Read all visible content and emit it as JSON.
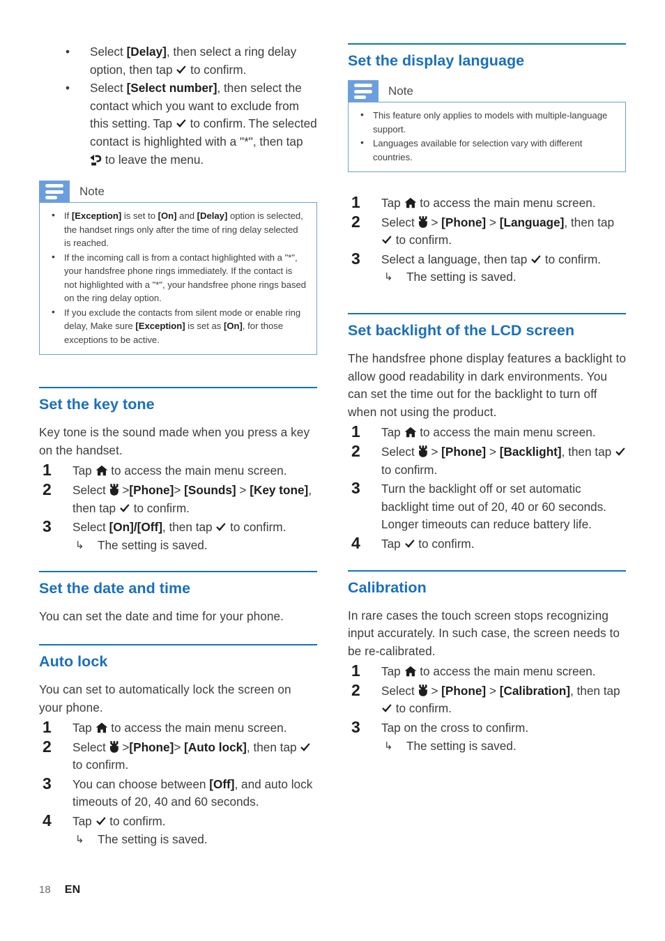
{
  "document": {
    "page_number": "18",
    "language_code": "EN"
  },
  "icons": {
    "check": "check-icon",
    "home": "home-icon",
    "wrench": "wrench-icon",
    "back": "back-arrow-icon",
    "sub_arrow": "sub-arrow-icon",
    "bullet": "•"
  },
  "colors": {
    "heading_blue": "#1a6fbd",
    "rule_blue": "#1272b6",
    "note_blue": "#6c9ede",
    "body_gray": "#3c3c3c"
  },
  "left_column": {
    "intro_bullets": [
      {
        "parts": [
          {
            "t": "Select ",
            "b": false
          },
          {
            "t": "[Delay]",
            "b": true
          },
          {
            "t": ", then select a ring delay option, then tap ",
            "b": false
          },
          {
            "t": "CHECK_ICON",
            "b": false
          },
          {
            "t": " to confirm.",
            "b": false
          }
        ],
        "plain": "Select [Delay], then select a ring delay option, then tap ✔ to confirm."
      },
      {
        "plain": "Select [Select number], then select the contact which you want to exclude from this setting. Tap ✔ to confirm. The selected contact is highlighted with a \"*\", then tap ↰ to leave the menu."
      }
    ],
    "note": {
      "title": "Note",
      "items": [
        "If [Exception] is set to [On] and [Delay] option is selected, the handset rings only after the time of ring delay selected is reached.",
        "If the incoming call is from a contact highlighted with a \"*\", your handsfree phone rings immediately. If the contact is not highlighted with a \"*\", your handsfree phone rings based on the ring delay option.",
        "If you exclude the contacts from silent mode or enable ring delay, Make sure [Exception] is set as [On], for those exceptions to be active."
      ]
    },
    "sections": [
      {
        "title": "Set the key tone",
        "intro": "Key tone is the sound made when you press a key on the handset.",
        "steps": [
          {
            "n": "1",
            "text": "Tap ⌂ to access the main menu screen."
          },
          {
            "n": "2",
            "text": "Select ⚒ >[Phone]> [Sounds] > [Key tone], then tap ✔ to confirm."
          },
          {
            "n": "3",
            "text": "Select [On]/[Off], then tap ✔ to confirm.",
            "sub": "The setting is saved."
          }
        ]
      },
      {
        "title": "Set the date and time",
        "intro": "You can set the date and time for your phone.",
        "steps": []
      },
      {
        "title": "Auto lock",
        "intro": "You can set to automatically lock the screen on your phone.",
        "steps": [
          {
            "n": "1",
            "text": "Tap ⌂ to access the main menu screen."
          },
          {
            "n": "2",
            "text": "Select ⚒ >[Phone]> [Auto lock], then tap ✔ to confirm."
          },
          {
            "n": "3",
            "text": "You can choose between [Off], and auto lock timeouts of 20, 40 and 60 seconds."
          },
          {
            "n": "4",
            "text": "Tap ✔ to confirm.",
            "sub": "The setting is saved."
          }
        ]
      }
    ]
  },
  "right_column": {
    "language_section": {
      "title": "Set the display language",
      "note": {
        "title": "Note",
        "items": [
          "This feature only applies to models with multiple-language support.",
          "Languages available for selection vary with different countries."
        ]
      },
      "steps": [
        {
          "n": "1",
          "text": "Tap ⌂ to access the main menu screen."
        },
        {
          "n": "2",
          "text": "Select ⚒ > [Phone] > [Language], then tap ✔ to confirm."
        },
        {
          "n": "3",
          "text": "Select a language, then tap ✔ to confirm.",
          "sub": "The setting is saved."
        }
      ]
    },
    "backlight_section": {
      "title": "Set backlight of the LCD screen",
      "intro": "The handsfree phone display features a backlight to allow good readability in dark environments. You can set the time out for the backlight to turn off when not using the product.",
      "steps": [
        {
          "n": "1",
          "text": "Tap ⌂ to access the main menu screen."
        },
        {
          "n": "2",
          "text": "Select ⚒ > [Phone] > [Backlight], then tap ✔ to confirm."
        },
        {
          "n": "3",
          "text": "Turn the backlight off or set automatic backlight time out of 20, 40 or 60 seconds. Longer timeouts can reduce battery life."
        },
        {
          "n": "4",
          "text": "Tap ✔ to confirm."
        }
      ]
    },
    "calibration_section": {
      "title": "Calibration",
      "intro": "In rare cases the touch screen stops recognizing input accurately. In such case, the screen needs to be re-calibrated.",
      "steps": [
        {
          "n": "1",
          "text": "Tap ⌂ to access the main menu screen."
        },
        {
          "n": "2",
          "text": "Select ⚒ > [Phone] > [Calibration], then tap ✔ to confirm."
        },
        {
          "n": "3",
          "text": "Tap on the cross to confirm.",
          "sub": "The setting is saved."
        }
      ]
    }
  },
  "strings": {
    "select": "Select",
    "tap": "Tap",
    "to_confirm": "to confirm.",
    "setting_saved": "The setting is saved.",
    "delay": "[Delay]",
    "select_number": "[Select number]",
    "exception": "[Exception]",
    "on": "[On]",
    "off": "[Off]",
    "on_off": "[On]/[Off]",
    "phone": "[Phone]",
    "sounds": "[Sounds]",
    "key_tone": "[Key tone]",
    "auto_lock": "[Auto lock]",
    "language": "[Language]",
    "backlight": "[Backlight]",
    "calibration": "[Calibration]",
    "gt": ">"
  }
}
